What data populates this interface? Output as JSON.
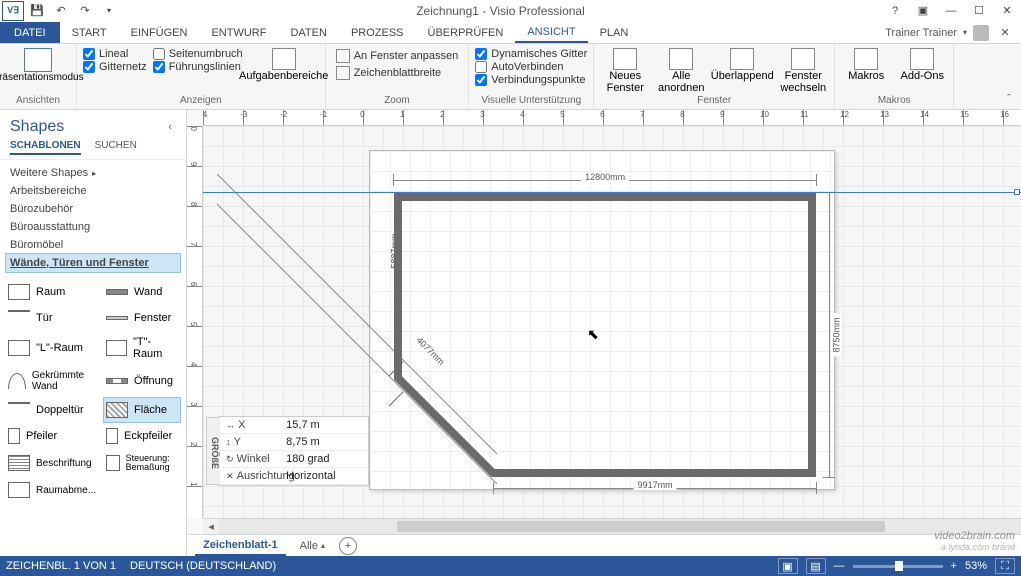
{
  "titlebar": {
    "title": "Zeichnung1 - Visio Professional"
  },
  "ribbon": {
    "tabs": {
      "file": "DATEI",
      "start": "START",
      "einfuegen": "EINFÜGEN",
      "entwurf": "ENTWURF",
      "daten": "DATEN",
      "prozess": "PROZESS",
      "ueberpruefen": "ÜBERPRÜFEN",
      "ansicht": "ANSICHT",
      "plan": "PLAN"
    },
    "user": "Trainer Trainer",
    "groups": {
      "ansichten": {
        "label": "Ansichten",
        "praesentation": "Präsentationsmodus"
      },
      "anzeigen": {
        "label": "Anzeigen",
        "lineal": "Lineal",
        "gitternetz": "Gitternetz",
        "seitenumbruch": "Seitenumbruch",
        "fuehrungslinien": "Führungslinien",
        "aufgabenbereiche": "Aufgabenbereiche"
      },
      "zoom": {
        "label": "Zoom",
        "anfenster": "An Fenster anpassen",
        "zeichenblatt": "Zeichenblattbreite"
      },
      "visuelle": {
        "label": "Visuelle Unterstützung",
        "dyngitter": "Dynamisches Gitter",
        "autoverbinden": "AutoVerbinden",
        "verbindungspunkte": "Verbindungspunkte"
      },
      "fenster": {
        "label": "Fenster",
        "neues": "Neues Fenster",
        "alle": "Alle anordnen",
        "ueberlappend": "Überlappend",
        "wechseln": "Fenster wechseln"
      },
      "makros": {
        "label": "Makros",
        "makros": "Makros",
        "addons": "Add-Ons"
      }
    }
  },
  "shapes": {
    "title": "Shapes",
    "tabs": {
      "schablonen": "SCHABLONEN",
      "suchen": "SUCHEN"
    },
    "cats": {
      "weitere": "Weitere Shapes",
      "arbeitsbereiche": "Arbeitsbereiche",
      "buerozubehoer": "Bürozubehör",
      "bueroausstattung": "Büroausstattung",
      "bueromoebel": "Büromöbel",
      "waende": "Wände, Türen und Fenster"
    },
    "items": {
      "raum": "Raum",
      "wand": "Wand",
      "tuer": "Tür",
      "fenster": "Fenster",
      "lraum": "\"L\"-Raum",
      "traum": "\"T\"-Raum",
      "gekruemmt": "Gekrümmte Wand",
      "oeffnung": "Öffnung",
      "doppeltuer": "Doppeltür",
      "flaeche": "Fläche",
      "pfeiler": "Pfeiler",
      "eckpfeiler": "Eckpfeiler",
      "beschriftung": "Beschriftung",
      "steuerung": "Steuerung: Bemaßung",
      "raumabme": "Raumabme..."
    }
  },
  "floatbox": {
    "side": "GRÖßE",
    "x_lbl": "X",
    "x_val": "15,7 m",
    "y_lbl": "Y",
    "y_val": "8,75 m",
    "winkel_lbl": "Winkel",
    "winkel_val": "180 grad",
    "ausr_lbl": "Ausrichtung",
    "ausr_val": "Horizontal"
  },
  "dims": {
    "top": "12800mm",
    "right": "8750mm",
    "diag": "4077mm",
    "bottom": "9917mm",
    "left": "5887mm"
  },
  "sheets": {
    "tab1": "Zeichenblatt-1",
    "all": "Alle"
  },
  "status": {
    "page": "ZEICHENBL. 1 VON 1",
    "lang": "DEUTSCH (DEUTSCHLAND)",
    "zoom": "53%"
  },
  "watermark": {
    "main": "video2brain.com",
    "sub": "a lynda.com brand"
  }
}
